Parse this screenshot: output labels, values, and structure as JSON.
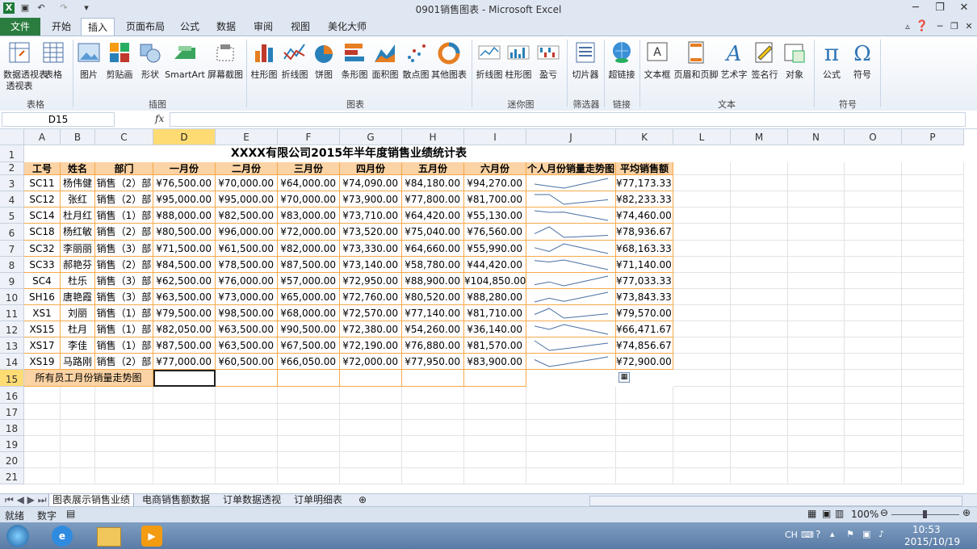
{
  "window": {
    "title": "0901销售图表 - Microsoft Excel"
  },
  "tabs": [
    "文件",
    "开始",
    "插入",
    "页面布局",
    "公式",
    "数据",
    "审阅",
    "视图",
    "美化大师"
  ],
  "ribbon": {
    "buttons": [
      {
        "label": "数据透视表",
        "label2": "透视表",
        "icon": "pivot-table-icon"
      },
      {
        "label": "表格",
        "icon": "table-icon"
      },
      {
        "label": "图片",
        "icon": "picture-icon"
      },
      {
        "label": "剪贴画",
        "icon": "clipart-icon"
      },
      {
        "label": "形状",
        "icon": "shapes-icon"
      },
      {
        "label": "SmartArt",
        "icon": "smartart-icon"
      },
      {
        "label": "屏幕截图",
        "icon": "screenshot-icon"
      },
      {
        "label": "柱形图",
        "icon": "column-chart-icon"
      },
      {
        "label": "折线图",
        "icon": "line-chart-icon"
      },
      {
        "label": "饼图",
        "icon": "pie-chart-icon"
      },
      {
        "label": "条形图",
        "icon": "bar-chart-icon"
      },
      {
        "label": "面积图",
        "icon": "area-chart-icon"
      },
      {
        "label": "散点图",
        "icon": "scatter-chart-icon"
      },
      {
        "label": "其他图表",
        "icon": "other-chart-icon"
      },
      {
        "label": "折线图",
        "icon": "sparkline-line-icon"
      },
      {
        "label": "柱形图",
        "icon": "sparkline-column-icon"
      },
      {
        "label": "盈亏",
        "icon": "sparkline-winloss-icon"
      },
      {
        "label": "切片器",
        "icon": "slicer-icon"
      },
      {
        "label": "超链接",
        "icon": "hyperlink-icon"
      },
      {
        "label": "文本框",
        "icon": "textbox-icon"
      },
      {
        "label": "页眉和页脚",
        "icon": "header-footer-icon"
      },
      {
        "label": "艺术字",
        "icon": "wordart-icon"
      },
      {
        "label": "签名行",
        "icon": "signature-icon"
      },
      {
        "label": "对象",
        "icon": "object-icon"
      },
      {
        "label": "公式",
        "icon": "equation-icon"
      },
      {
        "label": "符号",
        "icon": "symbol-icon"
      }
    ],
    "groups": [
      "表格",
      "插图",
      "图表",
      "迷你图",
      "筛选器",
      "链接",
      "文本",
      "符号"
    ]
  },
  "formula_bar": {
    "name_box": "D15",
    "fx": "fx",
    "value": ""
  },
  "columns": [
    "A",
    "B",
    "C",
    "D",
    "E",
    "F",
    "G",
    "H",
    "I",
    "J",
    "K",
    "L",
    "M",
    "N",
    "O",
    "P"
  ],
  "rows": [
    "1",
    "2",
    "3",
    "4",
    "5",
    "6",
    "7",
    "8",
    "9",
    "10",
    "11",
    "12",
    "13",
    "14",
    "15",
    "16",
    "17",
    "18",
    "19",
    "20",
    "21"
  ],
  "sheet": {
    "title": "XXXX有限公司2015年半年度销售业绩统计表",
    "headers": [
      "工号",
      "姓名",
      "部门",
      "一月份",
      "二月份",
      "三月份",
      "四月份",
      "五月份",
      "六月份",
      "个人月份销量走势图",
      "平均销售额"
    ],
    "records": [
      {
        "id": "SC11",
        "name": "杨伟健",
        "dept": "销售（2）部",
        "m": [
          "¥76,500.00",
          "¥70,000.00",
          "¥64,000.00",
          "¥74,090.00",
          "¥84,180.00",
          "¥94,270.00"
        ],
        "avg": "¥77,173.33",
        "trend": [
          76500,
          70000,
          64000,
          74090,
          84180,
          94270
        ]
      },
      {
        "id": "SC12",
        "name": "张红",
        "dept": "销售（2）部",
        "m": [
          "¥95,000.00",
          "¥95,000.00",
          "¥70,000.00",
          "¥73,900.00",
          "¥77,800.00",
          "¥81,700.00"
        ],
        "avg": "¥82,233.33",
        "trend": [
          95000,
          95000,
          70000,
          73900,
          77800,
          81700
        ]
      },
      {
        "id": "SC14",
        "name": "杜月红",
        "dept": "销售（1）部",
        "m": [
          "¥88,000.00",
          "¥82,500.00",
          "¥83,000.00",
          "¥73,710.00",
          "¥64,420.00",
          "¥55,130.00"
        ],
        "avg": "¥74,460.00",
        "trend": [
          88000,
          82500,
          83000,
          73710,
          64420,
          55130
        ]
      },
      {
        "id": "SC18",
        "name": "杨红敏",
        "dept": "销售（2）部",
        "m": [
          "¥80,500.00",
          "¥96,000.00",
          "¥72,000.00",
          "¥73,520.00",
          "¥75,040.00",
          "¥76,560.00"
        ],
        "avg": "¥78,936.67",
        "trend": [
          80500,
          96000,
          72000,
          73520,
          75040,
          76560
        ]
      },
      {
        "id": "SC32",
        "name": "李丽丽",
        "dept": "销售（3）部",
        "m": [
          "¥71,500.00",
          "¥61,500.00",
          "¥82,000.00",
          "¥73,330.00",
          "¥64,660.00",
          "¥55,990.00"
        ],
        "avg": "¥68,163.33",
        "trend": [
          71500,
          61500,
          82000,
          73330,
          64660,
          55990
        ]
      },
      {
        "id": "SC33",
        "name": "郝艳芬",
        "dept": "销售（2）部",
        "m": [
          "¥84,500.00",
          "¥78,500.00",
          "¥87,500.00",
          "¥73,140.00",
          "¥58,780.00",
          "¥44,420.00"
        ],
        "avg": "¥71,140.00",
        "trend": [
          84500,
          78500,
          87500,
          73140,
          58780,
          44420
        ]
      },
      {
        "id": "SC4",
        "name": "杜乐",
        "dept": "销售（3）部",
        "m": [
          "¥62,500.00",
          "¥76,000.00",
          "¥57,000.00",
          "¥72,950.00",
          "¥88,900.00",
          "¥104,850.00"
        ],
        "avg": "¥77,033.33",
        "trend": [
          62500,
          76000,
          57000,
          72950,
          88900,
          104850
        ]
      },
      {
        "id": "SH16",
        "name": "唐艳霞",
        "dept": "销售（3）部",
        "m": [
          "¥63,500.00",
          "¥73,000.00",
          "¥65,000.00",
          "¥72,760.00",
          "¥80,520.00",
          "¥88,280.00"
        ],
        "avg": "¥73,843.33",
        "trend": [
          63500,
          73000,
          65000,
          72760,
          80520,
          88280
        ]
      },
      {
        "id": "XS1",
        "name": "刘丽",
        "dept": "销售（1）部",
        "m": [
          "¥79,500.00",
          "¥98,500.00",
          "¥68,000.00",
          "¥72,570.00",
          "¥77,140.00",
          "¥81,710.00"
        ],
        "avg": "¥79,570.00",
        "trend": [
          79500,
          98500,
          68000,
          72570,
          77140,
          81710
        ]
      },
      {
        "id": "XS15",
        "name": "杜月",
        "dept": "销售（1）部",
        "m": [
          "¥82,050.00",
          "¥63,500.00",
          "¥90,500.00",
          "¥72,380.00",
          "¥54,260.00",
          "¥36,140.00"
        ],
        "avg": "¥66,471.67",
        "trend": [
          82050,
          63500,
          90500,
          72380,
          54260,
          36140
        ]
      },
      {
        "id": "XS17",
        "name": "李佳",
        "dept": "销售（1）部",
        "m": [
          "¥87,500.00",
          "¥63,500.00",
          "¥67,500.00",
          "¥72,190.00",
          "¥76,880.00",
          "¥81,570.00"
        ],
        "avg": "¥74,856.67",
        "trend": [
          87500,
          63500,
          67500,
          72190,
          76880,
          81570
        ]
      },
      {
        "id": "XS19",
        "name": "马路刚",
        "dept": "销售（2）部",
        "m": [
          "¥77,000.00",
          "¥60,500.00",
          "¥66,050.00",
          "¥72,000.00",
          "¥77,950.00",
          "¥83,900.00"
        ],
        "avg": "¥72,900.00",
        "trend": [
          77000,
          60500,
          66050,
          72000,
          77950,
          83900
        ]
      }
    ],
    "footer_label": "所有员工月份销量走势图"
  },
  "sheet_tabs": [
    "图表展示销售业绩",
    "电商销售额数据",
    "订单数据透视",
    "订单明细表"
  ],
  "status": {
    "ready": "就绪",
    "mode": "数字",
    "zoom": "100%"
  },
  "taskbar": {
    "lang": "CH",
    "time": "10:53",
    "date": "2015/10/19"
  },
  "colors": {
    "header_fill": "#fbd3a4",
    "table_border": "#f6a94b",
    "file_tab": "#2a7d3f",
    "sparkline": "#4a6fa5"
  }
}
